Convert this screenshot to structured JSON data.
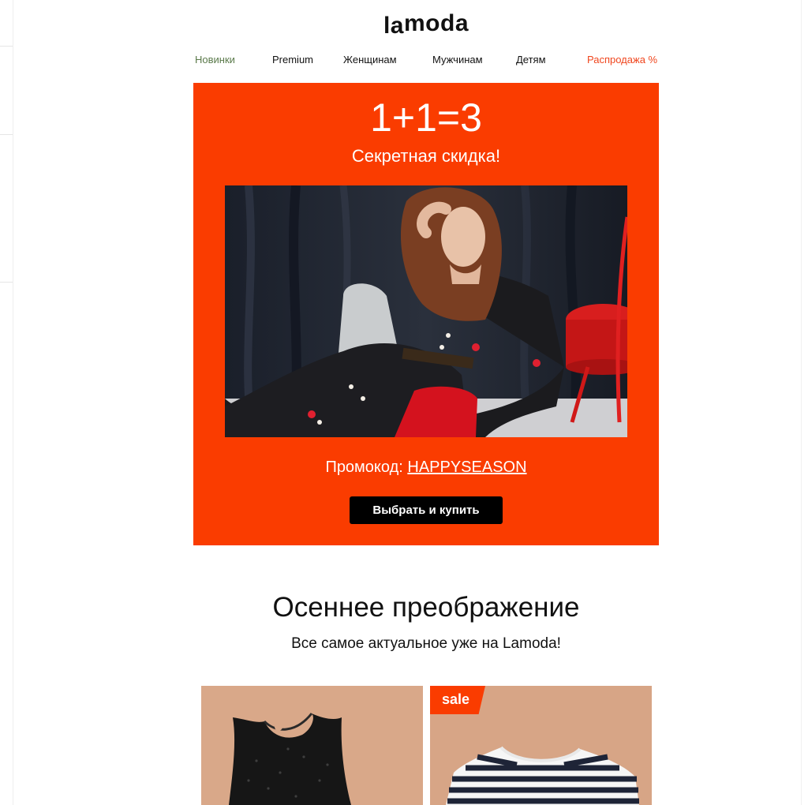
{
  "brand": {
    "logo_text": "lamoda"
  },
  "nav": {
    "items": [
      {
        "label": "Новинки",
        "color": "#5b7a4b"
      },
      {
        "label": "Premium",
        "color": "#111111"
      },
      {
        "label": "Женщинам",
        "color": "#111111"
      },
      {
        "label": "Мужчинам",
        "color": "#111111"
      },
      {
        "label": "Детям",
        "color": "#111111"
      },
      {
        "label": "Распродажа %",
        "color": "#f0461e"
      }
    ]
  },
  "hero": {
    "title": "1+1=3",
    "subtitle": "Секретная скидка!",
    "promo_label": "Промокод: ",
    "promo_code": "HAPPYSEASON",
    "cta_label": "Выбрать и купить",
    "background_color": "#fa3c00"
  },
  "section": {
    "title": "Осеннее преображение",
    "subtitle": "Все самое актуальное уже на Lamoda!"
  },
  "products": [
    {
      "image": "black-sequin-top",
      "badge": ""
    },
    {
      "image": "striped-longsleeve",
      "badge": "sale"
    }
  ]
}
